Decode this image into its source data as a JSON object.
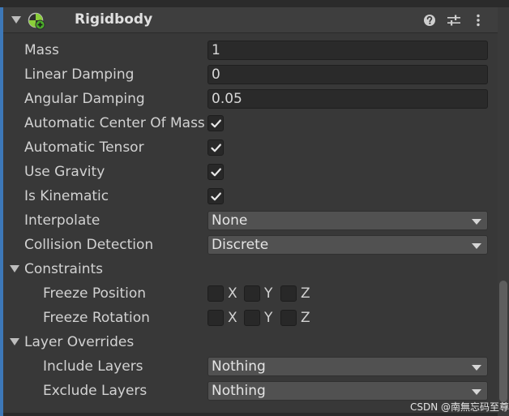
{
  "header": {
    "title": "Rigidbody",
    "icons": {
      "foldout": "triangle-down-icon",
      "component": "rigidbody-icon",
      "help": "question-icon",
      "presets": "sliders-icon",
      "menu": "kebab-menu-icon"
    }
  },
  "fields": {
    "mass": {
      "label": "Mass",
      "value": "1"
    },
    "linear_damping": {
      "label": "Linear Damping",
      "value": "0"
    },
    "angular_damping": {
      "label": "Angular Damping",
      "value": "0.05"
    },
    "auto_center_of_mass": {
      "label": "Automatic Center Of Mass",
      "checked": true
    },
    "auto_tensor": {
      "label": "Automatic Tensor",
      "checked": true
    },
    "use_gravity": {
      "label": "Use Gravity",
      "checked": true
    },
    "is_kinematic": {
      "label": "Is Kinematic",
      "checked": true
    },
    "interpolate": {
      "label": "Interpolate",
      "value": "None"
    },
    "collision_detection": {
      "label": "Collision Detection",
      "value": "Discrete"
    }
  },
  "constraints": {
    "label": "Constraints",
    "freeze_position": {
      "label": "Freeze Position",
      "x": "X",
      "y": "Y",
      "z": "Z"
    },
    "freeze_rotation": {
      "label": "Freeze Rotation",
      "x": "X",
      "y": "Y",
      "z": "Z"
    }
  },
  "layer_overrides": {
    "label": "Layer Overrides",
    "include_layers": {
      "label": "Include Layers",
      "value": "Nothing"
    },
    "exclude_layers": {
      "label": "Exclude Layers",
      "value": "Nothing"
    }
  },
  "watermark": "CSDN @南無忘码至尊",
  "colors": {
    "accent": "#3d78b8",
    "background": "#383838",
    "field": "#2a2a2a",
    "dropdown": "#515151",
    "icon_green": "#4caf2a"
  }
}
